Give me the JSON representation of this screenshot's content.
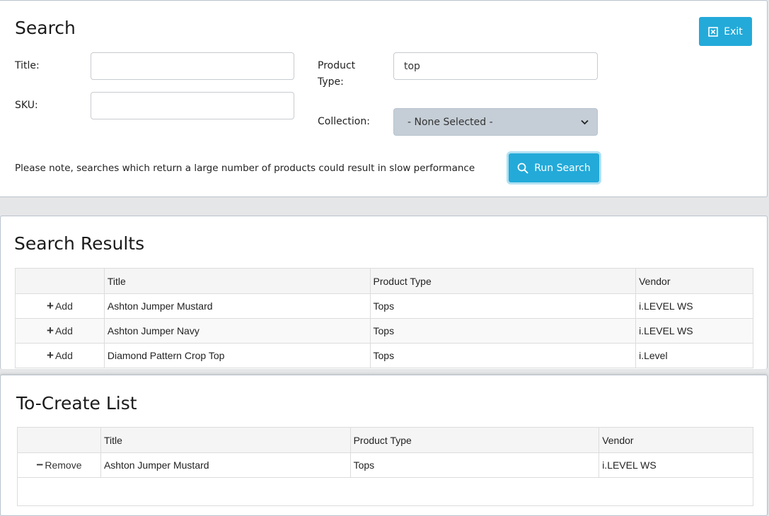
{
  "search": {
    "title": "Search",
    "exit_label": "Exit",
    "title_label": "Title:",
    "title_value": "",
    "sku_label": "SKU:",
    "sku_value": "",
    "product_type_label_1": "Product",
    "product_type_label_2": "Type:",
    "product_type_value": "top",
    "collection_label": "Collection:",
    "collection_selected": "- None Selected -",
    "note": "Please note, searches which return a large number of products could result in slow performance",
    "run_label": "Run Search"
  },
  "results": {
    "title": "Search Results",
    "columns": [
      "",
      "Title",
      "Product Type",
      "Vendor"
    ],
    "add_label": "Add",
    "rows": [
      {
        "title": "Ashton Jumper Mustard",
        "type": "Tops",
        "vendor": "i.LEVEL WS"
      },
      {
        "title": "Ashton Jumper Navy",
        "type": "Tops",
        "vendor": "i.LEVEL WS"
      },
      {
        "title": "Diamond Pattern Crop Top",
        "type": "Tops",
        "vendor": "i.Level"
      }
    ]
  },
  "create": {
    "title": "To-Create List",
    "columns": [
      "",
      "Title",
      "Product Type",
      "Vendor"
    ],
    "remove_label": "Remove",
    "rows": [
      {
        "title": "Ashton Jumper Mustard",
        "type": "Tops",
        "vendor": "i.LEVEL WS"
      }
    ]
  },
  "colors": {
    "accent": "#23aad9",
    "select_bg": "#c5ced6",
    "page_bg": "#e5e6e8"
  }
}
